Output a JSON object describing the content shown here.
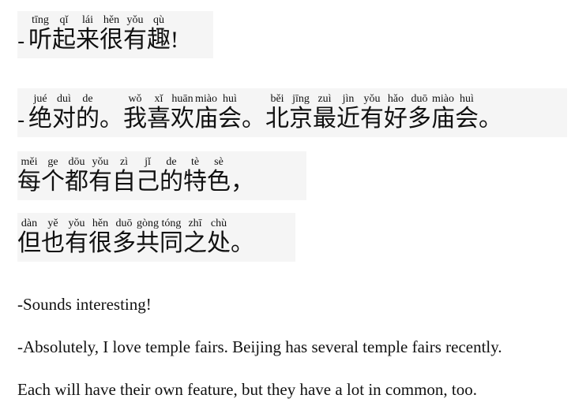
{
  "dialogue": {
    "line1": {
      "dash": "-",
      "chars": [
        {
          "han": "听",
          "py": "tīng"
        },
        {
          "han": "起",
          "py": "qǐ"
        },
        {
          "han": "来",
          "py": "lái"
        },
        {
          "han": "很",
          "py": "hěn"
        },
        {
          "han": "有",
          "py": "yǒu"
        },
        {
          "han": "趣",
          "py": "qù"
        }
      ],
      "end": "!"
    },
    "line2": {
      "dash": "-",
      "chars": [
        {
          "han": "绝",
          "py": "jué"
        },
        {
          "han": "对",
          "py": "duì"
        },
        {
          "han": "的",
          "py": "de"
        },
        {
          "han": "。",
          "py": ""
        },
        {
          "han": "我",
          "py": "wǒ"
        },
        {
          "han": "喜",
          "py": "xǐ"
        },
        {
          "han": "欢",
          "py": "huān"
        },
        {
          "han": "庙",
          "py": "miào"
        },
        {
          "han": "会",
          "py": "huì"
        },
        {
          "han": "。",
          "py": ""
        },
        {
          "han": "北",
          "py": "běi"
        },
        {
          "han": "京",
          "py": "jīng"
        },
        {
          "han": "最",
          "py": "zuì"
        },
        {
          "han": "近",
          "py": "jìn"
        },
        {
          "han": "有",
          "py": "yǒu"
        },
        {
          "han": "好",
          "py": "hǎo"
        },
        {
          "han": "多",
          "py": "duō"
        },
        {
          "han": "庙",
          "py": "miào"
        },
        {
          "han": "会",
          "py": "huì"
        },
        {
          "han": "。",
          "py": ""
        }
      ]
    },
    "line3": {
      "chars": [
        {
          "han": "每",
          "py": "měi"
        },
        {
          "han": "个",
          "py": "ge"
        },
        {
          "han": "都",
          "py": "dōu"
        },
        {
          "han": "有",
          "py": "yǒu"
        },
        {
          "han": "自",
          "py": "zì"
        },
        {
          "han": "己",
          "py": "jǐ"
        },
        {
          "han": "的",
          "py": "de"
        },
        {
          "han": "特",
          "py": "tè"
        },
        {
          "han": "色",
          "py": "sè"
        },
        {
          "han": "，",
          "py": ""
        }
      ]
    },
    "line4": {
      "chars": [
        {
          "han": "但",
          "py": "dàn"
        },
        {
          "han": "也",
          "py": "yě"
        },
        {
          "han": "有",
          "py": "yǒu"
        },
        {
          "han": "很",
          "py": "hěn"
        },
        {
          "han": "多",
          "py": "duō"
        },
        {
          "han": "共",
          "py": "gòng"
        },
        {
          "han": "同",
          "py": "tóng"
        },
        {
          "han": "之",
          "py": "zhī"
        },
        {
          "han": "处",
          "py": "chù"
        },
        {
          "han": "。",
          "py": ""
        }
      ]
    }
  },
  "translation": {
    "line1": "-Sounds interesting!",
    "line2": "-Absolutely, I love temple fairs. Beijing has several temple fairs recently.",
    "line3": "Each will have their own feature, but they have a lot in common, too."
  }
}
